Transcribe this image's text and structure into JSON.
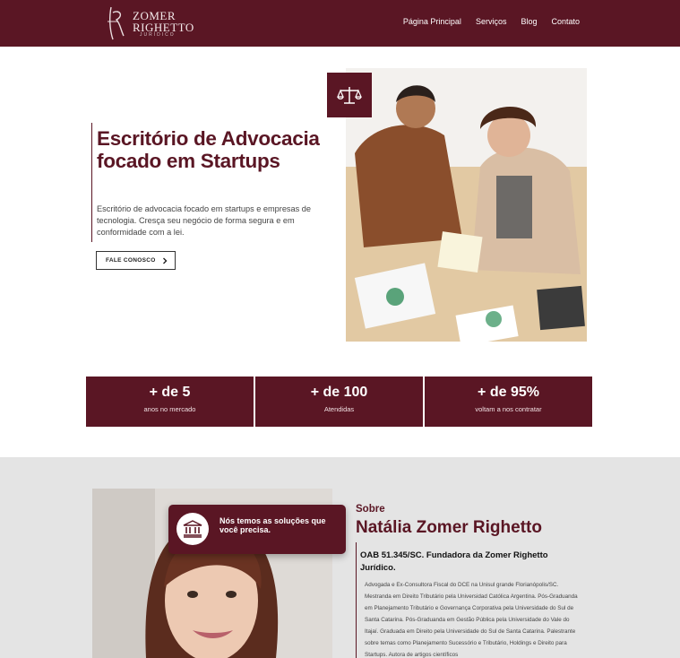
{
  "header": {
    "logo": {
      "name_line1": "ZOMER",
      "name_line2": "RIGHETTO",
      "sub": "JURÍDICO"
    },
    "nav": [
      "Página Principal",
      "Serviços",
      "Blog",
      "Contato"
    ]
  },
  "hero": {
    "title": "Escritório de Advocacia focado em Startups",
    "text": "Escritório de advocacia focado em startups e empresas de tecnologia. Cresça seu negócio de forma segura e em conformidade com a lei.",
    "cta": "FALE CONOSCO",
    "badge_icon": "scales-icon"
  },
  "stats": [
    {
      "value": "+ de 5",
      "label": "anos no mercado"
    },
    {
      "value": "+ de 100",
      "label": "Atendidas"
    },
    {
      "value": "+ de 95%",
      "label": "voltam a nos contratar"
    }
  ],
  "about": {
    "card_text": "Nós temos as soluções que você precisa.",
    "card_icon": "bank-icon",
    "kicker": "Sobre",
    "name": "Natália Zomer Righetto",
    "oab": "OAB 51.345/SC. Fundadora da Zomer Righetto Jurídico.",
    "bio": "Advogada e Ex-Consultora Fiscal do DCE na Unisul grande Florianópolis/SC. Mestranda em Direito Tributário pela Universidad Católica Argentina. Pós-Graduanda em Planejamento Tributário e Governança Corporativa pela Universidade do Sul de Santa Catarina. Pós-Graduanda em Gestão Pública pela Universidade do Vale do Itajaí. Graduada em Direito pela Universidade do Sul de Santa Catarina. Palestrante sobre temas como Planejamento Sucessório e Tributário, Holdings e Direito para Startups. Autora de artigos científicos"
  },
  "colors": {
    "brand": "#5a1624",
    "about_bg": "#e4e4e4"
  }
}
